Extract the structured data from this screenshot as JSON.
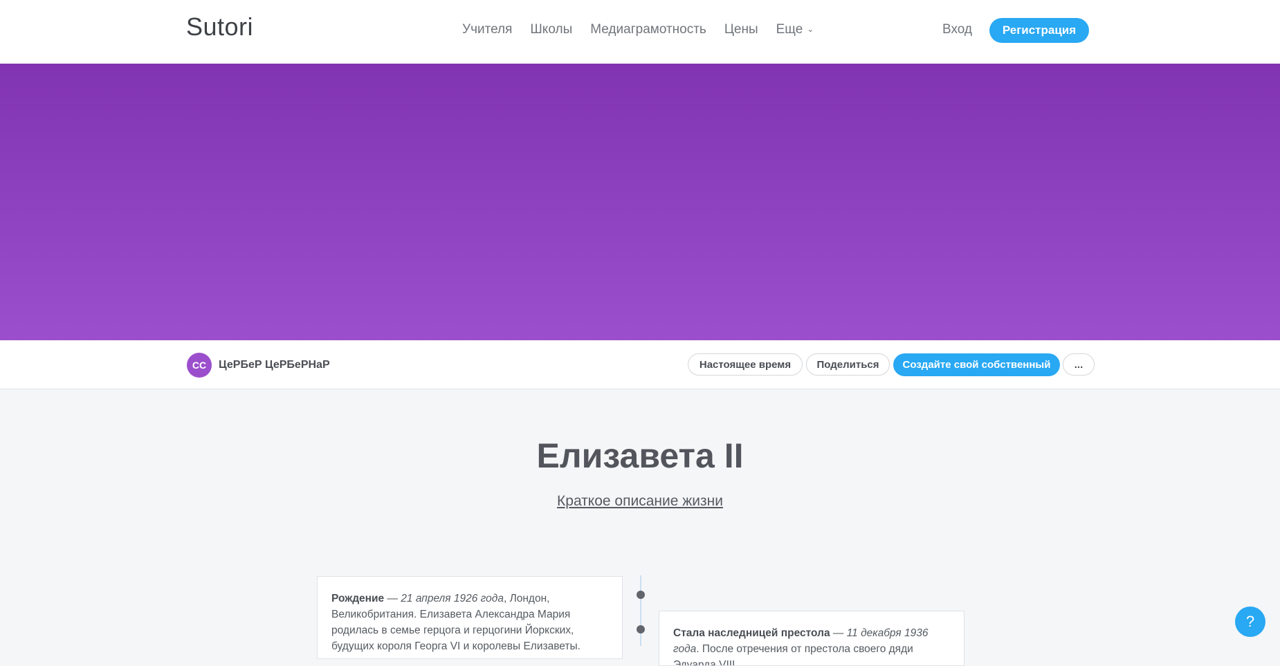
{
  "header": {
    "logo": "Sutori",
    "nav": [
      "Учителя",
      "Школы",
      "Медиаграмотность",
      "Цены",
      "Еще"
    ],
    "login": "Вход",
    "signup": "Регистрация"
  },
  "banner": {
    "color_top": "#8134b1",
    "color_bottom": "#9b4fcc"
  },
  "author": {
    "initials": "CC",
    "name": "ЦеРБеР ЦеРБеРНаР",
    "buttons": {
      "realtime": "Настоящее время",
      "share": "Поделиться",
      "create": "Создайте свой собственный",
      "more": "..."
    }
  },
  "story": {
    "title": "Елизавета II",
    "subtitle": "Краткое описание жизни"
  },
  "timeline": [
    {
      "label": "Рождение",
      "sep": " — ",
      "date": "21 апреля 1926 года",
      "text": ", Лондон, Великобритания. Елизавета Александра Мария родилась в семье герцога и герцогини Йоркских, будущих короля Георга VI и королевы Елизаветы."
    },
    {
      "label": "Стала наследницей престола",
      "sep": " — ",
      "date": "11 декабря 1936 года",
      "text": ". После отречения от престола своего дяди Эдуарда VIII"
    }
  ],
  "help_icon": "?",
  "colors": {
    "accent": "#29a8f3",
    "avatar": "#9b4fcc"
  }
}
